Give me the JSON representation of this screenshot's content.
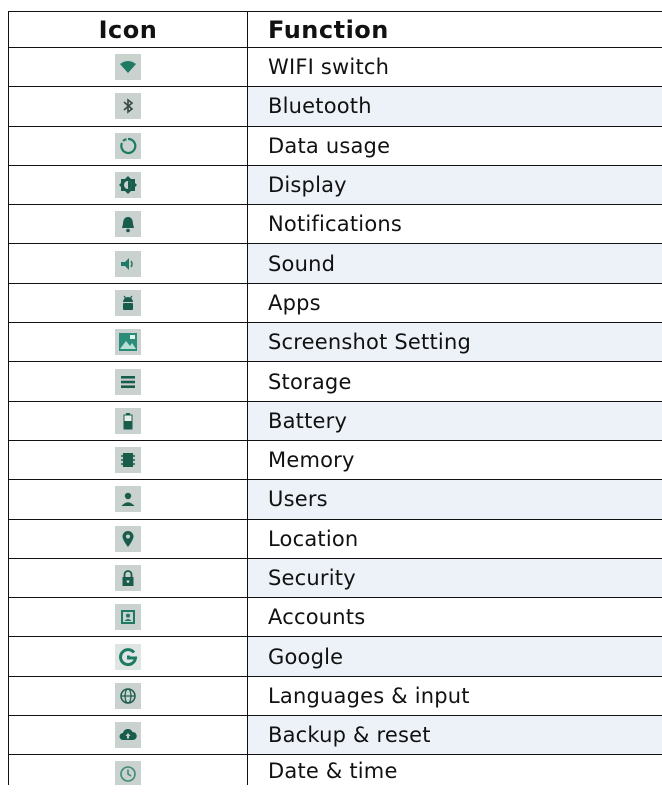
{
  "header": {
    "icon_col": "Icon",
    "function_col": "Function"
  },
  "rows": [
    {
      "icon": "wifi-icon",
      "label": "WIFI switch"
    },
    {
      "icon": "bluetooth-icon",
      "label": "Bluetooth"
    },
    {
      "icon": "data-usage-icon",
      "label": "Data usage"
    },
    {
      "icon": "display-icon",
      "label": "Display"
    },
    {
      "icon": "bell-icon",
      "label": "Notifications"
    },
    {
      "icon": "speaker-icon",
      "label": "Sound"
    },
    {
      "icon": "android-icon",
      "label": "Apps"
    },
    {
      "icon": "image-icon",
      "label": "Screenshot Setting"
    },
    {
      "icon": "storage-icon",
      "label": "Storage"
    },
    {
      "icon": "battery-icon",
      "label": "Battery"
    },
    {
      "icon": "memory-icon",
      "label": "Memory"
    },
    {
      "icon": "user-icon",
      "label": "Users"
    },
    {
      "icon": "location-pin-icon",
      "label": "Location"
    },
    {
      "icon": "lock-icon",
      "label": "Security"
    },
    {
      "icon": "account-box-icon",
      "label": "Accounts"
    },
    {
      "icon": "google-icon",
      "label": "Google"
    },
    {
      "icon": "globe-icon",
      "label": "Languages & input"
    },
    {
      "icon": "cloud-upload-icon",
      "label": "Backup & reset"
    },
    {
      "icon": "clock-icon",
      "label": "Date & time"
    }
  ],
  "colors": {
    "icon_green": "#1f7a63",
    "icon_bg": "#c9d2cf",
    "row_alt_bg": "#edf2f8"
  }
}
